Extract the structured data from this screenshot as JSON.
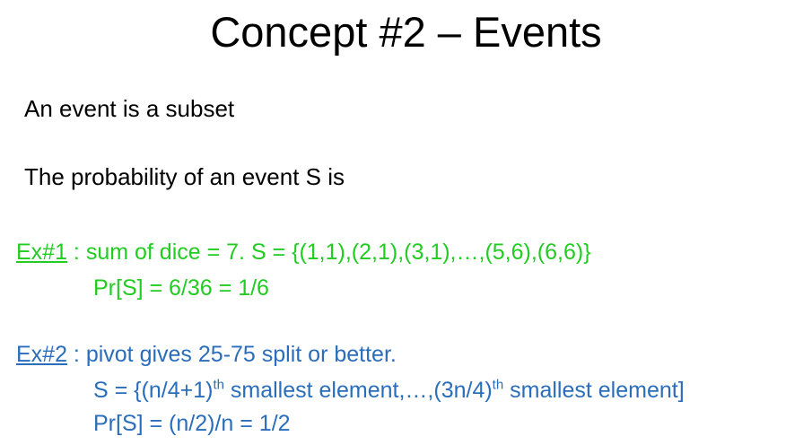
{
  "title": "Concept #2 – Events",
  "bullets": {
    "line1": "An event is a subset",
    "line2": "The probability of an event S is"
  },
  "ex1": {
    "label": "Ex#1",
    "text": " : sum of dice = 7. S = {(1,1),(2,1),(3,1),…,(5,6),(6,6)}",
    "prob": "Pr[S] = 6/36 = 1/6",
    "color": "#22cc22"
  },
  "ex2": {
    "label": "Ex#2",
    "text": " : pivot gives 25-75 split or better.",
    "s_part1": "S  = {(n/4+1)",
    "s_sup1": "th",
    "s_part2": " smallest element,…,(3n/4)",
    "s_sup2": "th",
    "s_part3": " smallest element]",
    "prob": "Pr[S] = (n/2)/n  = 1/2",
    "color": "#2a6ebb"
  }
}
